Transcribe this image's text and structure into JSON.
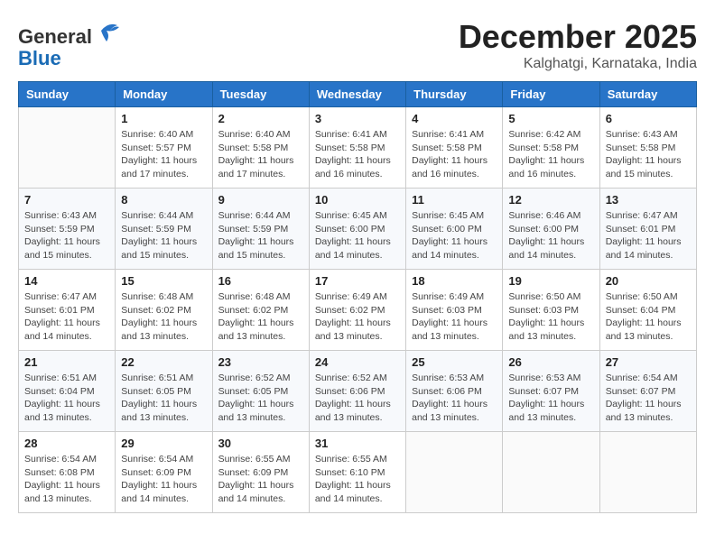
{
  "header": {
    "logo_line1": "General",
    "logo_line2": "Blue",
    "month": "December 2025",
    "location": "Kalghatgi, Karnataka, India"
  },
  "weekdays": [
    "Sunday",
    "Monday",
    "Tuesday",
    "Wednesday",
    "Thursday",
    "Friday",
    "Saturday"
  ],
  "weeks": [
    [
      {
        "day": "",
        "info": ""
      },
      {
        "day": "1",
        "info": "Sunrise: 6:40 AM\nSunset: 5:57 PM\nDaylight: 11 hours\nand 17 minutes."
      },
      {
        "day": "2",
        "info": "Sunrise: 6:40 AM\nSunset: 5:58 PM\nDaylight: 11 hours\nand 17 minutes."
      },
      {
        "day": "3",
        "info": "Sunrise: 6:41 AM\nSunset: 5:58 PM\nDaylight: 11 hours\nand 16 minutes."
      },
      {
        "day": "4",
        "info": "Sunrise: 6:41 AM\nSunset: 5:58 PM\nDaylight: 11 hours\nand 16 minutes."
      },
      {
        "day": "5",
        "info": "Sunrise: 6:42 AM\nSunset: 5:58 PM\nDaylight: 11 hours\nand 16 minutes."
      },
      {
        "day": "6",
        "info": "Sunrise: 6:43 AM\nSunset: 5:58 PM\nDaylight: 11 hours\nand 15 minutes."
      }
    ],
    [
      {
        "day": "7",
        "info": "Sunrise: 6:43 AM\nSunset: 5:59 PM\nDaylight: 11 hours\nand 15 minutes."
      },
      {
        "day": "8",
        "info": "Sunrise: 6:44 AM\nSunset: 5:59 PM\nDaylight: 11 hours\nand 15 minutes."
      },
      {
        "day": "9",
        "info": "Sunrise: 6:44 AM\nSunset: 5:59 PM\nDaylight: 11 hours\nand 15 minutes."
      },
      {
        "day": "10",
        "info": "Sunrise: 6:45 AM\nSunset: 6:00 PM\nDaylight: 11 hours\nand 14 minutes."
      },
      {
        "day": "11",
        "info": "Sunrise: 6:45 AM\nSunset: 6:00 PM\nDaylight: 11 hours\nand 14 minutes."
      },
      {
        "day": "12",
        "info": "Sunrise: 6:46 AM\nSunset: 6:00 PM\nDaylight: 11 hours\nand 14 minutes."
      },
      {
        "day": "13",
        "info": "Sunrise: 6:47 AM\nSunset: 6:01 PM\nDaylight: 11 hours\nand 14 minutes."
      }
    ],
    [
      {
        "day": "14",
        "info": "Sunrise: 6:47 AM\nSunset: 6:01 PM\nDaylight: 11 hours\nand 14 minutes."
      },
      {
        "day": "15",
        "info": "Sunrise: 6:48 AM\nSunset: 6:02 PM\nDaylight: 11 hours\nand 13 minutes."
      },
      {
        "day": "16",
        "info": "Sunrise: 6:48 AM\nSunset: 6:02 PM\nDaylight: 11 hours\nand 13 minutes."
      },
      {
        "day": "17",
        "info": "Sunrise: 6:49 AM\nSunset: 6:02 PM\nDaylight: 11 hours\nand 13 minutes."
      },
      {
        "day": "18",
        "info": "Sunrise: 6:49 AM\nSunset: 6:03 PM\nDaylight: 11 hours\nand 13 minutes."
      },
      {
        "day": "19",
        "info": "Sunrise: 6:50 AM\nSunset: 6:03 PM\nDaylight: 11 hours\nand 13 minutes."
      },
      {
        "day": "20",
        "info": "Sunrise: 6:50 AM\nSunset: 6:04 PM\nDaylight: 11 hours\nand 13 minutes."
      }
    ],
    [
      {
        "day": "21",
        "info": "Sunrise: 6:51 AM\nSunset: 6:04 PM\nDaylight: 11 hours\nand 13 minutes."
      },
      {
        "day": "22",
        "info": "Sunrise: 6:51 AM\nSunset: 6:05 PM\nDaylight: 11 hours\nand 13 minutes."
      },
      {
        "day": "23",
        "info": "Sunrise: 6:52 AM\nSunset: 6:05 PM\nDaylight: 11 hours\nand 13 minutes."
      },
      {
        "day": "24",
        "info": "Sunrise: 6:52 AM\nSunset: 6:06 PM\nDaylight: 11 hours\nand 13 minutes."
      },
      {
        "day": "25",
        "info": "Sunrise: 6:53 AM\nSunset: 6:06 PM\nDaylight: 11 hours\nand 13 minutes."
      },
      {
        "day": "26",
        "info": "Sunrise: 6:53 AM\nSunset: 6:07 PM\nDaylight: 11 hours\nand 13 minutes."
      },
      {
        "day": "27",
        "info": "Sunrise: 6:54 AM\nSunset: 6:07 PM\nDaylight: 11 hours\nand 13 minutes."
      }
    ],
    [
      {
        "day": "28",
        "info": "Sunrise: 6:54 AM\nSunset: 6:08 PM\nDaylight: 11 hours\nand 13 minutes."
      },
      {
        "day": "29",
        "info": "Sunrise: 6:54 AM\nSunset: 6:09 PM\nDaylight: 11 hours\nand 14 minutes."
      },
      {
        "day": "30",
        "info": "Sunrise: 6:55 AM\nSunset: 6:09 PM\nDaylight: 11 hours\nand 14 minutes."
      },
      {
        "day": "31",
        "info": "Sunrise: 6:55 AM\nSunset: 6:10 PM\nDaylight: 11 hours\nand 14 minutes."
      },
      {
        "day": "",
        "info": ""
      },
      {
        "day": "",
        "info": ""
      },
      {
        "day": "",
        "info": ""
      }
    ]
  ]
}
